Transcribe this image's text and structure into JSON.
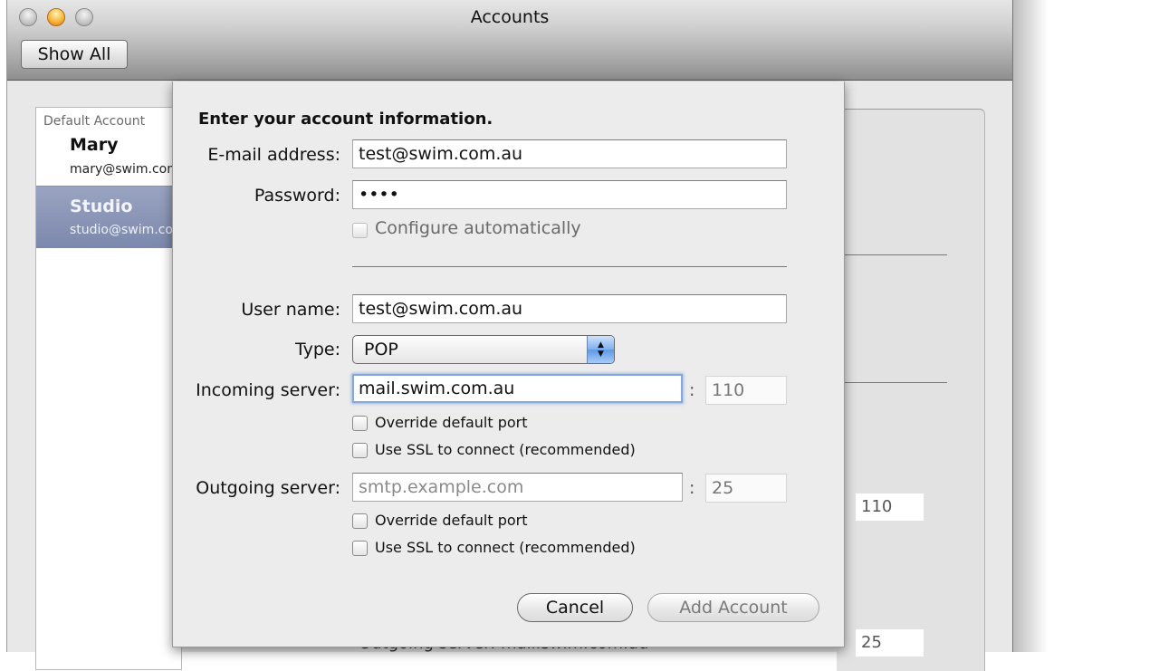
{
  "window": {
    "title": "Accounts",
    "controls": [
      "close",
      "minimize",
      "zoom"
    ],
    "show_all_label": "Show All"
  },
  "accounts": {
    "section_label": "Default Account",
    "items": [
      {
        "name": "Mary",
        "email": "mary@swim.com.au",
        "selected": false
      },
      {
        "name": "Studio",
        "email": "studio@swim.com.au",
        "selected": true
      }
    ]
  },
  "background": {
    "incoming_port": "110",
    "outgoing_port": "25",
    "outgoing_row_text": "Outgoing server:  mail.swim.com.au"
  },
  "sheet": {
    "heading": "Enter your account information.",
    "email": {
      "label": "E-mail address:",
      "value": "test@swim.com.au"
    },
    "password": {
      "label": "Password:",
      "value": "••••"
    },
    "configure_automatically": {
      "label": "Configure automatically",
      "checked": false,
      "enabled": false
    },
    "username": {
      "label": "User name:",
      "value": "test@swim.com.au"
    },
    "type": {
      "label": "Type:",
      "selected": "POP"
    },
    "incoming": {
      "label": "Incoming server:",
      "value": "mail.swim.com.au",
      "port": "110",
      "override_port": {
        "label": "Override default port",
        "checked": false
      },
      "use_ssl": {
        "label": "Use SSL to connect (recommended)",
        "checked": false
      }
    },
    "outgoing": {
      "label": "Outgoing server:",
      "value": "",
      "placeholder": "smtp.example.com",
      "port": "25",
      "override_port": {
        "label": "Override default port",
        "checked": false
      },
      "use_ssl": {
        "label": "Use SSL to connect (recommended)",
        "checked": false
      }
    },
    "colon": ":",
    "cancel_label": "Cancel",
    "add_account_label": "Add Account"
  },
  "icons": {
    "stepper": "▲▼"
  },
  "colors": {
    "selection": "#7c88ac",
    "focus_ring": "#86a8d8",
    "stepper_blue": "#5e98e6"
  }
}
